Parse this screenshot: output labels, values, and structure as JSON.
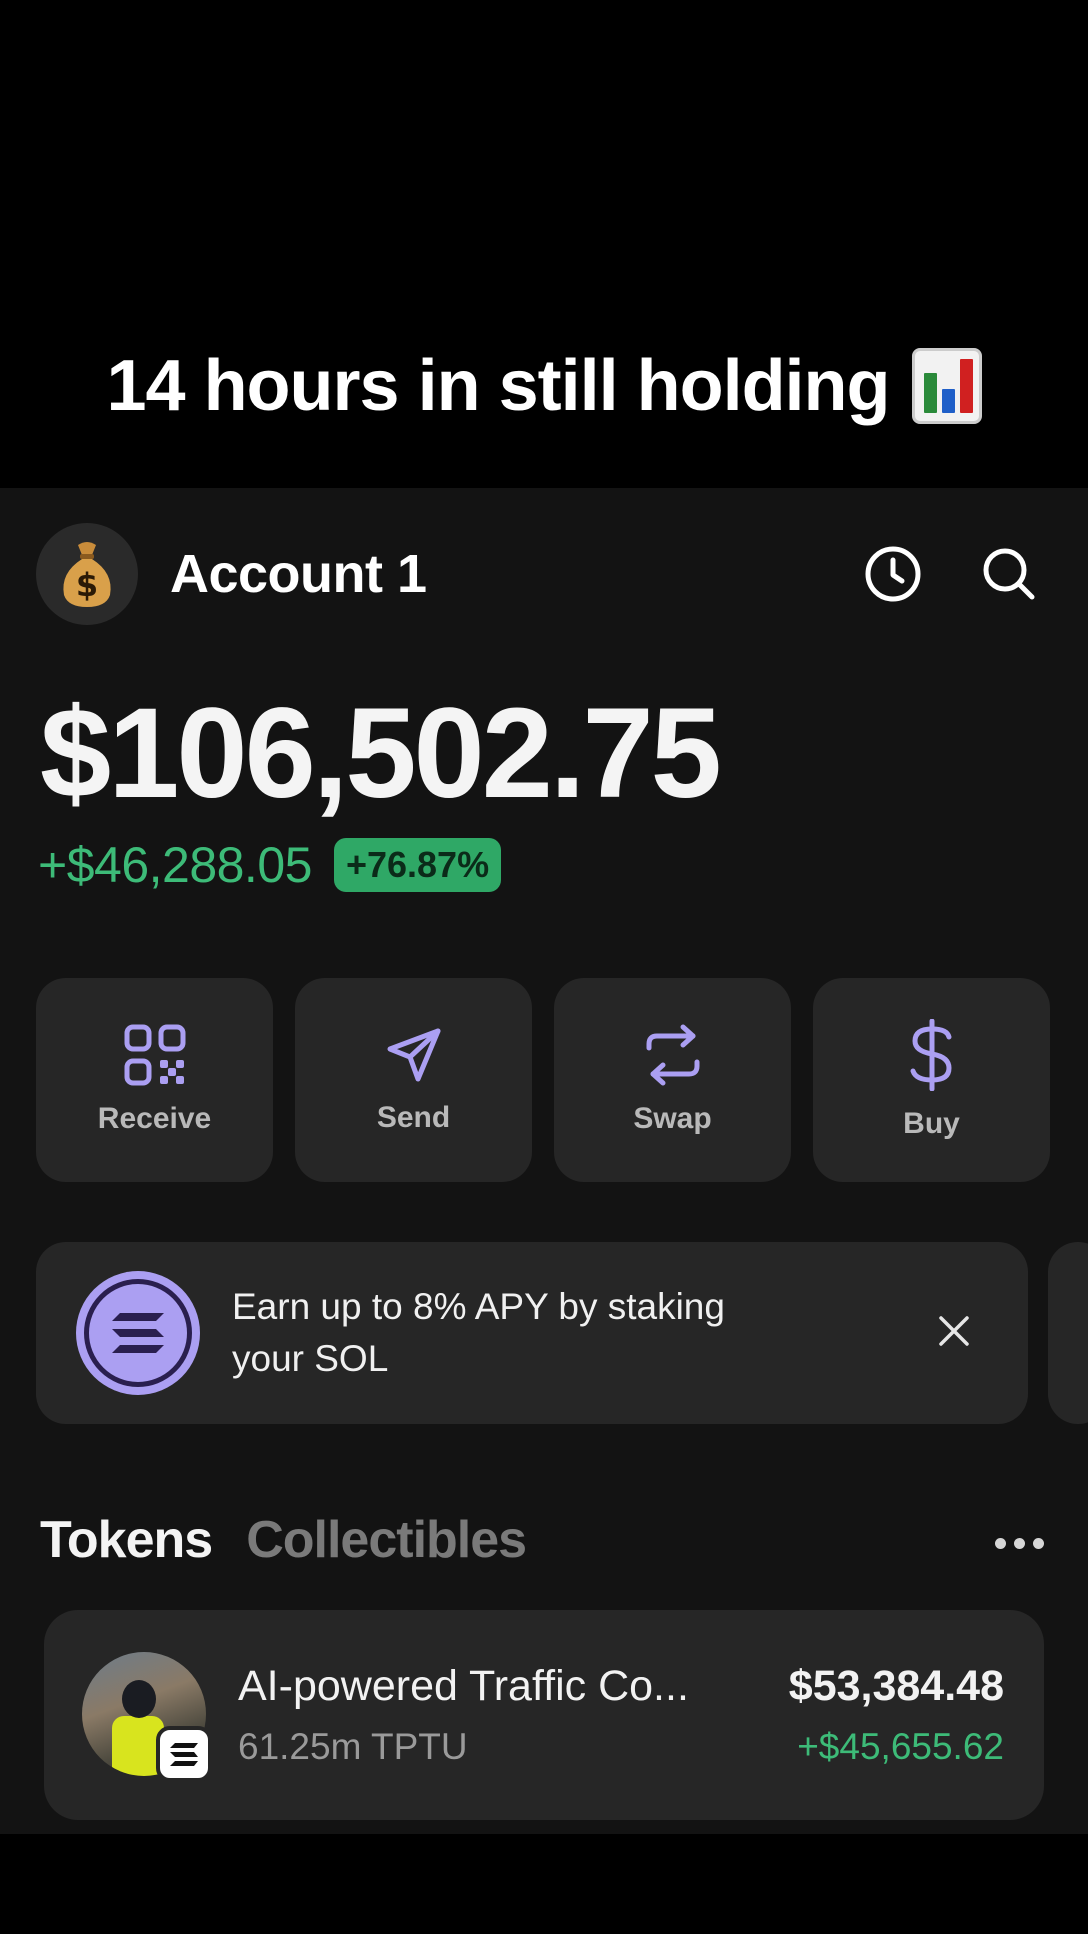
{
  "caption": {
    "text": "14 hours in still holding",
    "emoji": "bar-chart-emoji"
  },
  "header": {
    "avatar_icon": "money-bag-icon",
    "account_name": "Account 1",
    "icons": [
      "history-clock-icon",
      "search-icon"
    ]
  },
  "portfolio": {
    "balance": "$106,502.75",
    "change_amount": "+$46,288.05",
    "change_percent": "+76.87%"
  },
  "actions": [
    {
      "label": "Receive",
      "icon": "qr-code-icon"
    },
    {
      "label": "Send",
      "icon": "paper-plane-icon"
    },
    {
      "label": "Swap",
      "icon": "swap-arrows-icon"
    },
    {
      "label": "Buy",
      "icon": "dollar-icon"
    }
  ],
  "promo": {
    "text": "Earn up to 8% APY by staking your SOL",
    "icon": "solana-icon",
    "close_icon": "close-icon"
  },
  "tabs": {
    "active": "Tokens",
    "inactive": "Collectibles",
    "more_icon": "more-dots-icon"
  },
  "tokens": [
    {
      "name": "AI-powered Traffic Co...",
      "quantity": "61.25m TPTU",
      "value": "$53,384.48",
      "change": "+$45,655.62"
    }
  ],
  "colors": {
    "background": "#131313",
    "card": "#262626",
    "positive": "#3dbb78",
    "accent_purple": "#ab9ff2"
  }
}
